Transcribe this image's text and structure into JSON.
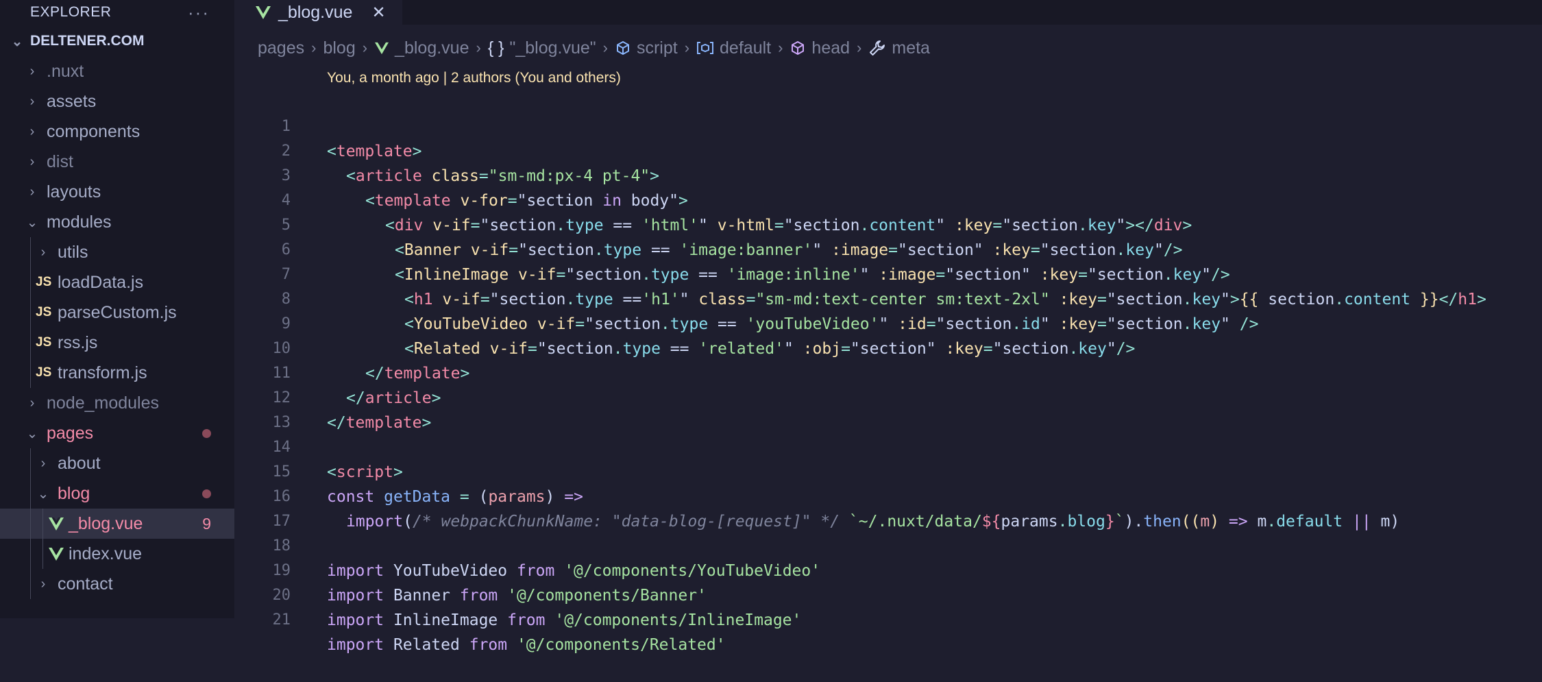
{
  "colors": {
    "sidebar_bg": "#181825",
    "editor_bg": "#1e1e2e",
    "modified": "#f38ba8",
    "blame": "#f9e2af",
    "vue_green": "#a6e3a1"
  },
  "sidebar": {
    "title": "EXPLORER",
    "more_icon": "ellipsis-icon",
    "root": "DELTENER.COM",
    "items": [
      {
        "label": ".nuxt"
      },
      {
        "label": "assets"
      },
      {
        "label": "components"
      },
      {
        "label": "dist"
      },
      {
        "label": "layouts"
      },
      {
        "label": "modules"
      },
      {
        "label": "utils"
      },
      {
        "label": "loadData.js",
        "icon": "JS"
      },
      {
        "label": "parseCustom.js",
        "icon": "JS"
      },
      {
        "label": "rss.js",
        "icon": "JS"
      },
      {
        "label": "transform.js",
        "icon": "JS"
      },
      {
        "label": "node_modules"
      },
      {
        "label": "pages"
      },
      {
        "label": "about"
      },
      {
        "label": "blog"
      },
      {
        "label": "_blog.vue",
        "badge": "9"
      },
      {
        "label": "index.vue"
      },
      {
        "label": "contact"
      }
    ]
  },
  "tab": {
    "label": "_blog.vue"
  },
  "breadcrumb": [
    "pages",
    "blog",
    "_blog.vue",
    "\"_blog.vue\"",
    "script",
    "default",
    "head",
    "meta"
  ],
  "breadcrumb_icons": {
    "braces": "{ }"
  },
  "blame": "You, a month ago | 2 authors (You and others)",
  "line_numbers": [
    "1",
    "2",
    "3",
    "4",
    "5",
    "6",
    "7",
    "8",
    "9",
    "10",
    "11",
    "12",
    "13",
    "14",
    "15",
    "16",
    "17",
    "18",
    "19",
    "20",
    "21"
  ],
  "code": {
    "l1": [
      "<",
      "template",
      ">"
    ],
    "l2": [
      "<",
      "article",
      " class",
      "=",
      "\"sm-md:px-4 pt-4\"",
      ">"
    ],
    "l3": [
      "<",
      "template",
      " v-for",
      "=",
      "\"section ",
      "in",
      " body\"",
      ">"
    ],
    "l4": [
      "<",
      "div",
      " v-if",
      "=",
      "\"section",
      ".",
      "type",
      " == ",
      "'html'",
      "\"",
      " v-html",
      "=",
      "\"section",
      ".",
      "content",
      "\"",
      " :key",
      "=",
      "\"section",
      ".",
      "key",
      "\"",
      "></",
      "div",
      ">"
    ],
    "l5": [
      "<",
      "Banner",
      " v-if",
      "=",
      "\"section",
      ".",
      "type",
      " == ",
      "'image:banner'",
      "\"",
      " :image",
      "=",
      "\"section\"",
      " :key",
      "=",
      "\"section",
      ".",
      "key",
      "\"",
      "/>"
    ],
    "l6": [
      "<",
      "InlineImage",
      " v-if",
      "=",
      "\"section",
      ".",
      "type",
      " == ",
      "'image:inline'",
      "\"",
      " :image",
      "=",
      "\"section\"",
      " :key",
      "=",
      "\"section",
      ".",
      "key",
      "\"",
      "/>"
    ],
    "l7": [
      "<",
      "h1",
      " v-if",
      "=",
      "\"section",
      ".",
      "type",
      " ==",
      "'h1'",
      "\"",
      " class",
      "=",
      "\"sm-md:text-center sm:text-2xl\"",
      " :key",
      "=",
      "\"section",
      ".",
      "key",
      "\"",
      ">",
      "{{",
      " section",
      ".",
      "content",
      " }}",
      "</",
      "h1",
      ">"
    ],
    "l8": [
      "<",
      "YouTubeVideo",
      " v-if",
      "=",
      "\"section",
      ".",
      "type",
      " == ",
      "'youTubeVideo'",
      "\"",
      " :id",
      "=",
      "\"section",
      ".",
      "id",
      "\"",
      " :key",
      "=",
      "\"section",
      ".",
      "key",
      "\"",
      " />"
    ],
    "l9": [
      "<",
      "Related",
      " v-if",
      "=",
      "\"section",
      ".",
      "type",
      " == ",
      "'related'",
      "\"",
      " :obj",
      "=",
      "\"section\"",
      " :key",
      "=",
      "\"section",
      ".",
      "key",
      "\"",
      "/>"
    ],
    "l10": [
      "</",
      "template",
      ">"
    ],
    "l11": [
      "</",
      "article",
      ">"
    ],
    "l12": [
      "</",
      "template",
      ">"
    ],
    "l14": [
      "<",
      "script",
      ">"
    ],
    "l15": [
      "const",
      " getData",
      " = ",
      "(",
      "params",
      ")",
      " =>"
    ],
    "l16": [
      "import",
      "(",
      "/* webpackChunkName: \"data-blog-[request]\" */",
      " `~/.nuxt/data/",
      "${",
      "params",
      ".",
      "blog",
      "}",
      "`",
      ").",
      "then",
      "((",
      "m",
      ")",
      " =>",
      " m",
      ".",
      "default",
      " ||",
      " m",
      ")"
    ],
    "l18": [
      "import",
      " YouTubeVideo ",
      "from",
      " '@/components/YouTubeVideo'"
    ],
    "l19": [
      "import",
      " Banner ",
      "from",
      " '@/components/Banner'"
    ],
    "l20": [
      "import",
      " InlineImage ",
      "from",
      " '@/components/InlineImage'"
    ],
    "l21": [
      "import",
      " Related ",
      "from",
      " '@/components/Related'"
    ]
  }
}
